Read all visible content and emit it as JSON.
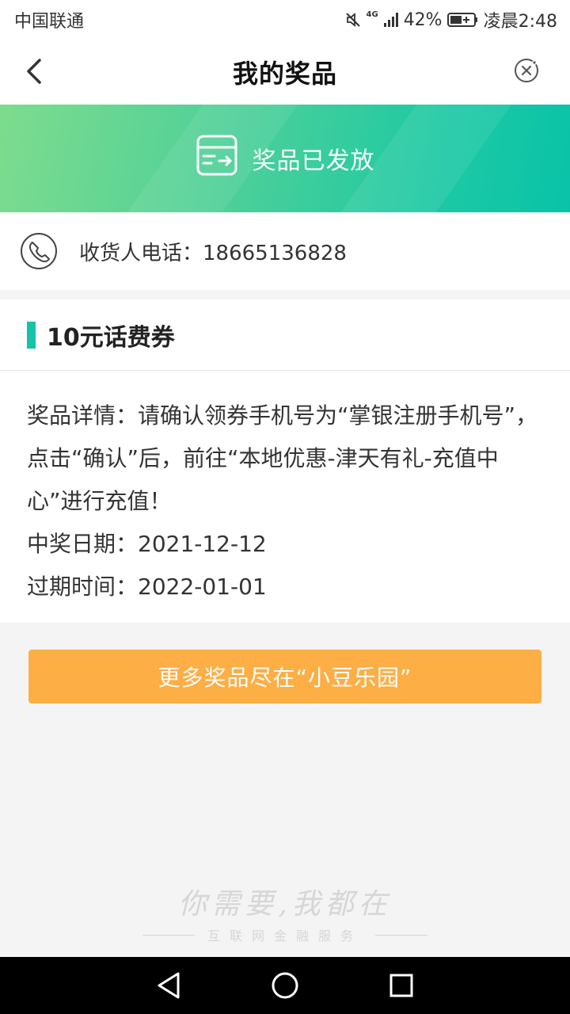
{
  "status_bar": {
    "carrier": "中国联通",
    "network": "4G",
    "battery": "42%",
    "time": "凌晨2:48"
  },
  "header": {
    "title": "我的奖品"
  },
  "banner": {
    "status_text": "奖品已发放"
  },
  "contact": {
    "phone_text": "收货人电话：18665136828"
  },
  "prize": {
    "name": "10元话费券",
    "details": "奖品详情：请确认领券手机号为“掌银注册手机号”，点击“确认”后，前往“本地优惠-津天有礼-充值中心”进行充值！",
    "win_date": "中奖日期：2021-12-12",
    "expire_date": "过期时间：2022-01-01"
  },
  "actions": {
    "more_label": "更多奖品尽在“小豆乐园”"
  },
  "watermark": {
    "slogan": "你需要,我都在",
    "sub": "互联网金融服务"
  },
  "colors": {
    "accent": "#14c3a8",
    "button": "#fdae45"
  }
}
